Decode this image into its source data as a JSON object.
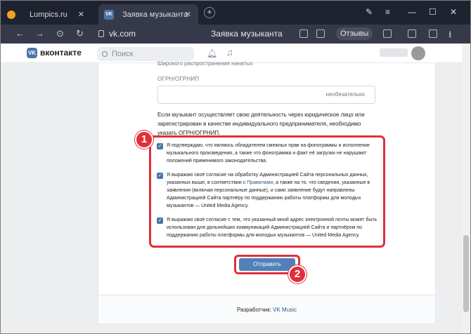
{
  "browser": {
    "tabs": [
      {
        "label": "Lumpics.ru",
        "active": false
      },
      {
        "label": "Заявка музыканта",
        "active": true
      }
    ],
    "url": "vk.com",
    "page_title": "Заявка музыканта",
    "reviews_label": "Отзывы",
    "window_controls": [
      "minimize-icon",
      "maximize-icon",
      "close-icon"
    ]
  },
  "vk": {
    "logo_text": "вконтакте",
    "search_placeholder": "Поиск"
  },
  "form": {
    "cut_text": "Широкого распространения начатых",
    "ogrn_label": "ОГРН/ОГРНИП",
    "ogrn_placeholder": "необязательно",
    "info_text": "Если музыкант осуществляет свою деятельность через юридическое лицо или зарегистрирован в качестве индивидуального предпринимателя, необходимо указать ОГРН/ОГРНИП.",
    "checkboxes": [
      {
        "checked": true,
        "text": "Я подтверждаю, что являюсь обладателем смежных прав на фонограммы и исполнение музыкального произведения, а также что фонограмма и факт её загрузки не нарушают положений применимого законодательства."
      },
      {
        "checked": true,
        "text_before": "Я выражаю своё согласие на обработку Администрацией Сайта персональных данных, указанных выше, в соответствии с ",
        "link": "Правилами",
        "text_after": ", а также на то, что сведения, указанные в заявлении (включая персональные данные), и само заявление будут направлены Администрацией Сайта партнёру по поддержанию работы платформы для молодых музыкантов — United Media Agency."
      },
      {
        "checked": true,
        "text": "Я выражаю своё согласие с тем, что указанный мной адрес электронной почты может быть использован для дальнейших коммуникаций Администрацией Сайта и партнёром по поддержанию работы платформы для молодых музыкантов — United Media Agency."
      }
    ],
    "submit_label": "Отправить"
  },
  "annotations": {
    "badge1": "1",
    "badge2": "2",
    "color": "#e0303a"
  },
  "footer": {
    "developer_label": "Разработчик: ",
    "developer_link": "VK Music"
  },
  "colors": {
    "vk_blue": "#4a76a8",
    "button": "#5181b8",
    "chrome_dark": "#1f2330"
  }
}
